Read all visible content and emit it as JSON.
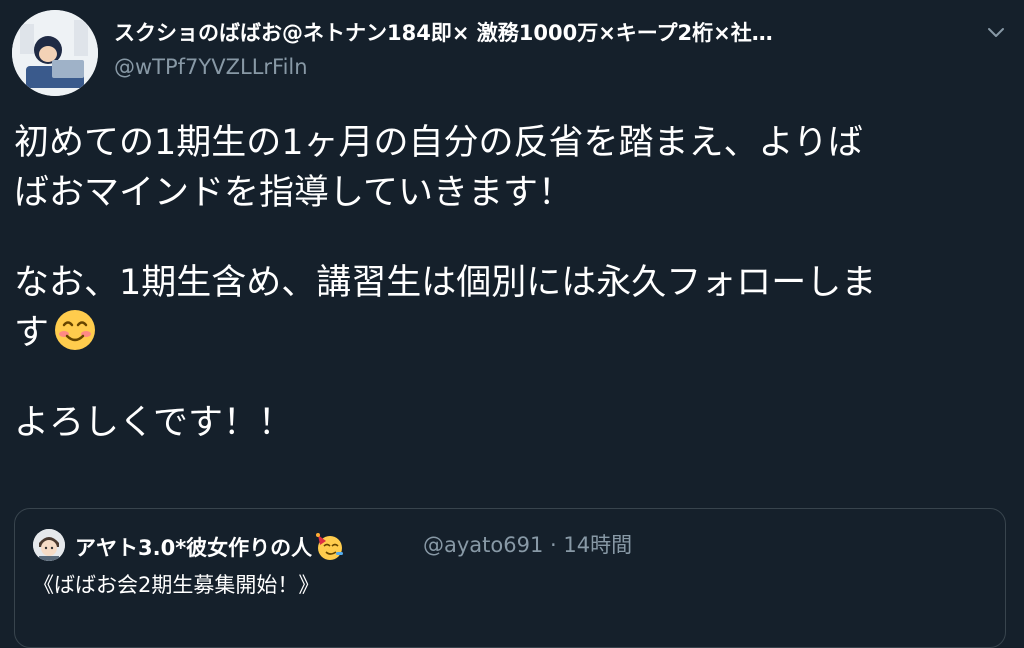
{
  "author": {
    "display_name": "スクショのばばお@ネトナン184即× 激務1000万×キープ2桁×社…",
    "handle": "@wTPf7YVZLLrFiln",
    "avatar_icon": "avatar-icon"
  },
  "tweet": {
    "lines": [
      "初めての1期生の1ヶ月の自分の反省を踏まえ、よりば",
      "ばおマインドを指導していきます！",
      "なお、1期生含め、講習生は個別には永久フォローしま",
      "す",
      "よろしくです！！"
    ],
    "emoji": "smiling-face-icon"
  },
  "quoted_tweet": {
    "display_name": "アヤト3.0*彼女作りの人",
    "name_emoji": "party-face-icon",
    "handle": "@ayato691",
    "separator": "·",
    "time": "14時間",
    "text": "《ばばお会2期生募集開始！》"
  },
  "colors": {
    "background": "#15202b",
    "primary_text": "#ffffff",
    "secondary_text": "#8899a6",
    "border": "#38444d"
  }
}
